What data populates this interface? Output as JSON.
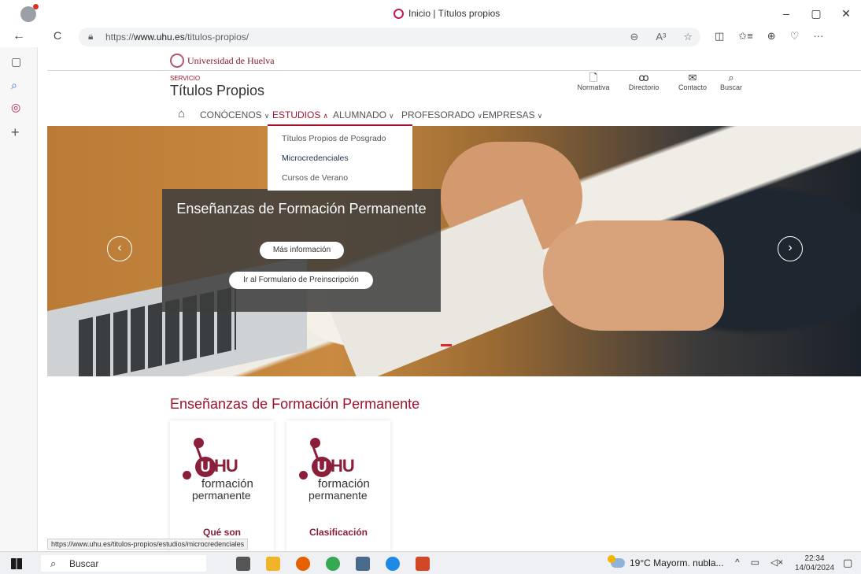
{
  "browser": {
    "tab_title": "Inicio | Títulos propios",
    "url_prefix": "https://",
    "url_host": "www.uhu.es",
    "url_path": "/titulos-propios/",
    "nav": {
      "back": "←",
      "refresh": "C"
    },
    "window": {
      "minimize": "–",
      "restore": "▢",
      "close": "✕"
    },
    "url_icons": [
      "⊖",
      "A³",
      "☆"
    ],
    "toolbar_icons": [
      "◫",
      "✩≡",
      "⊕",
      "♡",
      "···"
    ],
    "status_url": "https://www.uhu.es/titulos-propios/estudios/microcredenciales"
  },
  "sidebar": {
    "icons": [
      "▢",
      "⌕",
      "◎",
      "+"
    ]
  },
  "header": {
    "university": "Universidad de Huelva",
    "service_label": "SERVICIO",
    "site_title": "Títulos Propios",
    "links": [
      {
        "icon": "🗋",
        "label": "Normativa"
      },
      {
        "icon": "ꝏ",
        "label": "Directorio"
      },
      {
        "icon": "✉",
        "label": "Contacto"
      },
      {
        "icon": "⌕",
        "label": "Buscar"
      }
    ]
  },
  "nav": {
    "home_icon": "⌂",
    "items": [
      {
        "label": "CONÓCENOS",
        "chev": "∨"
      },
      {
        "label": "ESTUDIOS",
        "chev": "∧"
      },
      {
        "label": "ALUMNADO",
        "chev": "∨"
      },
      {
        "label": "PROFESORADO",
        "chev": "∨"
      },
      {
        "label": "EMPRESAS",
        "chev": "∨"
      }
    ],
    "dropdown": [
      "Títulos Propios de Posgrado",
      "Microcredenciales",
      "Cursos de Verano"
    ]
  },
  "hero": {
    "title": "Enseñanzas de Formación Permanente",
    "btn_more": "Más información",
    "btn_form": "Ir al Formulario de Preinscripción",
    "prev": "‹",
    "next": "›"
  },
  "section": {
    "title": "Enseñanzas de Formación Permanente",
    "cards": [
      {
        "logo_u": "U",
        "logo_hu": "HU",
        "logo_line1": "formación",
        "logo_line2": "permanente",
        "label": "Qué son"
      },
      {
        "logo_u": "U",
        "logo_hu": "HU",
        "logo_line1": "formación",
        "logo_line2": "permanente",
        "label": "Clasificación"
      }
    ]
  },
  "taskbar": {
    "search_placeholder": "Buscar",
    "weather": "19°C  Mayorm. nubla...",
    "tray": [
      "^",
      "▭",
      "◁×"
    ],
    "time": "22:34",
    "date": "14/04/2024",
    "notification": "▢"
  },
  "colors": {
    "brand": "#a3122c",
    "logo": "#8a1f3a"
  }
}
